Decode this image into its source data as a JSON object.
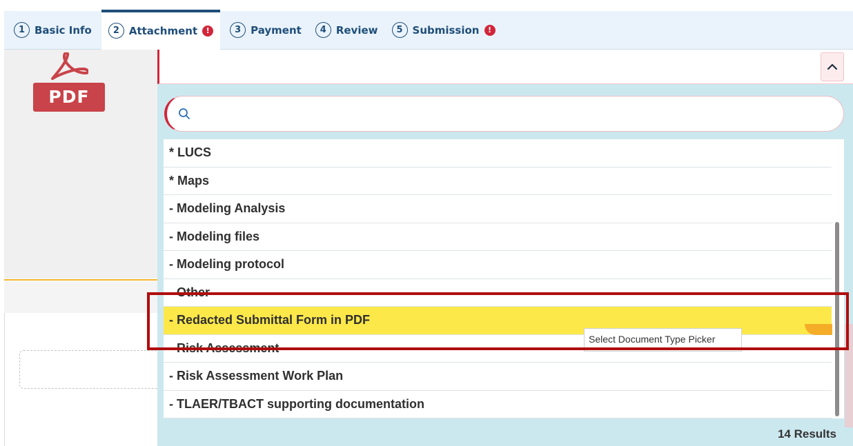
{
  "tabs": [
    {
      "num": "1",
      "label": "Basic Info",
      "active": false,
      "alert": ""
    },
    {
      "num": "2",
      "label": "Attachment",
      "active": true,
      "alert": "!"
    },
    {
      "num": "3",
      "label": "Payment",
      "active": false,
      "alert": ""
    },
    {
      "num": "4",
      "label": "Review",
      "active": false,
      "alert": ""
    },
    {
      "num": "5",
      "label": "Submission",
      "active": false,
      "alert": "!"
    }
  ],
  "file_icon": {
    "label": "PDF",
    "icon": "pdf-file-icon"
  },
  "select": {
    "value": "",
    "caret_icon": "chevron-up-icon"
  },
  "search": {
    "placeholder": "",
    "icon": "search-icon"
  },
  "options": [
    {
      "label": "* LUCS",
      "highlighted": false
    },
    {
      "label": "* Maps",
      "highlighted": false
    },
    {
      "label": "- Modeling Analysis",
      "highlighted": false
    },
    {
      "label": "- Modeling files",
      "highlighted": false
    },
    {
      "label": "- Modeling protocol",
      "highlighted": false
    },
    {
      "label": "- Other",
      "highlighted": false
    },
    {
      "label": "- Redacted Submittal Form in PDF",
      "highlighted": true
    },
    {
      "label": "- Risk Assessment",
      "highlighted": false
    },
    {
      "label": "- Risk Assessment Work Plan",
      "highlighted": false
    },
    {
      "label": "- TLAER/TBACT supporting documentation",
      "highlighted": false
    }
  ],
  "results_label": "14 Results",
  "tooltip": "Select Document Type Picker",
  "colors": {
    "accent": "#1f4e79",
    "error": "#d1263a",
    "highlight": "#fde84a",
    "dropdown_bg": "#cce8ef",
    "annotation": "#b00d0d"
  }
}
